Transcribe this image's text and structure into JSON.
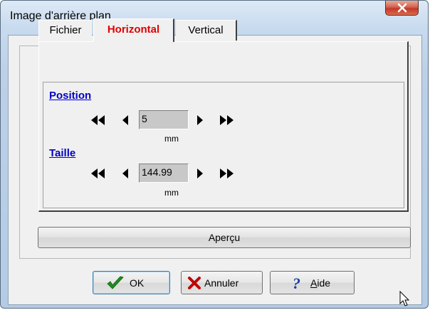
{
  "window": {
    "title": "Image d'arrière plan",
    "close_icon": "close-icon"
  },
  "tabs": [
    {
      "label": "Fichier",
      "active": false
    },
    {
      "label": "Horizontal",
      "active": true
    },
    {
      "label": "Vertical",
      "active": false
    }
  ],
  "position": {
    "label": "Position",
    "value": "5",
    "unit": "mm"
  },
  "taille": {
    "label": "Taille",
    "value": "144.99",
    "unit": "mm"
  },
  "buttons": {
    "apercu": "Aperçu",
    "ok": "OK",
    "annuler": "Annuler",
    "aide_mnemonic": "A",
    "aide_rest": "ide"
  },
  "colors": {
    "active_tab": "#e00000",
    "section_label": "#0000c8",
    "field_bg": "#c8c8c8"
  }
}
